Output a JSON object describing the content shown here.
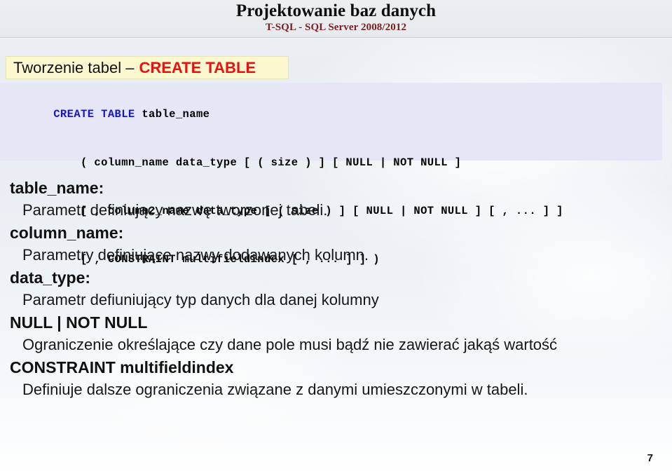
{
  "header": {
    "title": "Projektowanie baz danych",
    "subtitle": "T-SQL - SQL Server 2008/2012"
  },
  "heading": {
    "plain": "Tworzenie tabel –",
    "accent": "CREATE TABLE",
    "accent_color": "#e8110f",
    "background_color": "#fbf8cf"
  },
  "code": {
    "background_color": "#e6e6f7",
    "keyword_color": "#1414d2",
    "lines": [
      {
        "keyword": "CREATE TABLE",
        "rest": " table_name"
      },
      {
        "keyword": "",
        "rest": "    ( column_name data_type [ ( size ) ] [ NULL | NOT NULL ]"
      },
      {
        "keyword": "",
        "rest": "    [ , column2_name data_type [ ( size ) ] [ NULL | NOT NULL ] [ , ... ] ]"
      },
      {
        "keyword": "",
        "rest": "    [ , CONSTRAINT multifieldindex [ , ... ] ] )"
      }
    ]
  },
  "body": {
    "entries": [
      {
        "term": "table_name",
        "term_suffix": ":",
        "description": "Parametr definiujący nazwę tworzonej tabeli."
      },
      {
        "term": "column_name",
        "term_suffix": ":",
        "description": "Parametry definiujące nazwy dodawanych kolumn."
      },
      {
        "term": "data_type",
        "term_suffix": ":",
        "description": "Parametr defiuniujący typ danych dla danej kolumny"
      },
      {
        "term": "NULL | NOT NULL",
        "term_suffix": "",
        "description": "Ograniczenie określające czy dane pole musi bądź nie zawierać jakąś wartość"
      },
      {
        "term": "CONSTRAINT multifieldindex",
        "term_suffix": "",
        "description": "Definiuje dalsze ograniczenia związane z danymi umieszczonymi w tabeli."
      }
    ]
  },
  "footer": {
    "page_number": "7"
  }
}
